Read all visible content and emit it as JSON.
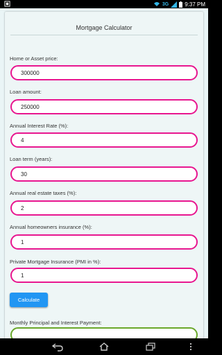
{
  "status_bar": {
    "network": "3G",
    "time": "9:37 PM",
    "icons": [
      "notification-icon",
      "wifi-icon",
      "signal-icon",
      "battery-icon"
    ]
  },
  "app": {
    "title": "Mortgage Calculator"
  },
  "form": {
    "home_price": {
      "label": "Home or Asset price:",
      "value": "300000"
    },
    "loan_amount": {
      "label": "Loan amount:",
      "value": "250000"
    },
    "interest_rate": {
      "label": "Annual Interest Rate (%):",
      "value": "4"
    },
    "loan_term": {
      "label": "Loan term (years):",
      "value": "30"
    },
    "real_estate_taxes": {
      "label": "Annual real estate taxes (%):",
      "value": "2"
    },
    "homeowners_insurance": {
      "label": "Annual homeowners insurance (%):",
      "value": "1"
    },
    "pmi": {
      "label": "Private Mortgage Insurance (PMI in %):",
      "value": "1"
    },
    "calculate_label": "Calculate",
    "result": {
      "label": "Monthly Principal and Interest Payment:",
      "value": ""
    }
  },
  "colors": {
    "field_border": "#e8168f",
    "result_border": "#6aa82b",
    "button": "#2196f3"
  },
  "nav_bar": {
    "icons": [
      "back-icon",
      "home-icon",
      "recent-apps-icon",
      "menu-icon"
    ]
  }
}
